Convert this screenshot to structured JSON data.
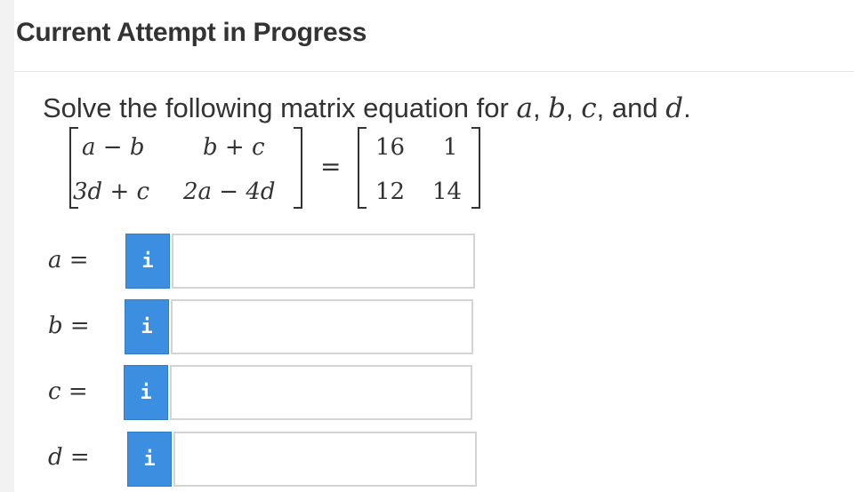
{
  "header": {
    "title": "Current Attempt in Progress"
  },
  "question": {
    "prompt_text": "Solve the following matrix equation for ",
    "vars_a": "a",
    "comma1": ", ",
    "vars_b": "b",
    "comma2": ", ",
    "vars_c": "c",
    "and_text": ", and ",
    "vars_d": "d",
    "period": ".",
    "left_matrix": {
      "r1c1": "a − b",
      "r1c2": "b + c",
      "r2c1": "3d + c",
      "r2c2": "2a − 4d"
    },
    "equals": "=",
    "right_matrix": {
      "r1c1": "16",
      "r1c2": "1",
      "r2c1": "12",
      "r2c2": "14"
    }
  },
  "answers": [
    {
      "label": "a",
      "eq": "=",
      "info_icon": "i",
      "value": "",
      "placeholder": ""
    },
    {
      "label": "b",
      "eq": "=",
      "info_icon": "i",
      "value": "",
      "placeholder": ""
    },
    {
      "label": "c",
      "eq": "=",
      "info_icon": "i",
      "value": "",
      "placeholder": ""
    },
    {
      "label": "d",
      "eq": "=",
      "info_icon": "i",
      "value": "",
      "placeholder": ""
    }
  ],
  "colors": {
    "info_button": "#3b8ee0",
    "input_border": "#d4d4d4",
    "text": "#333333"
  }
}
